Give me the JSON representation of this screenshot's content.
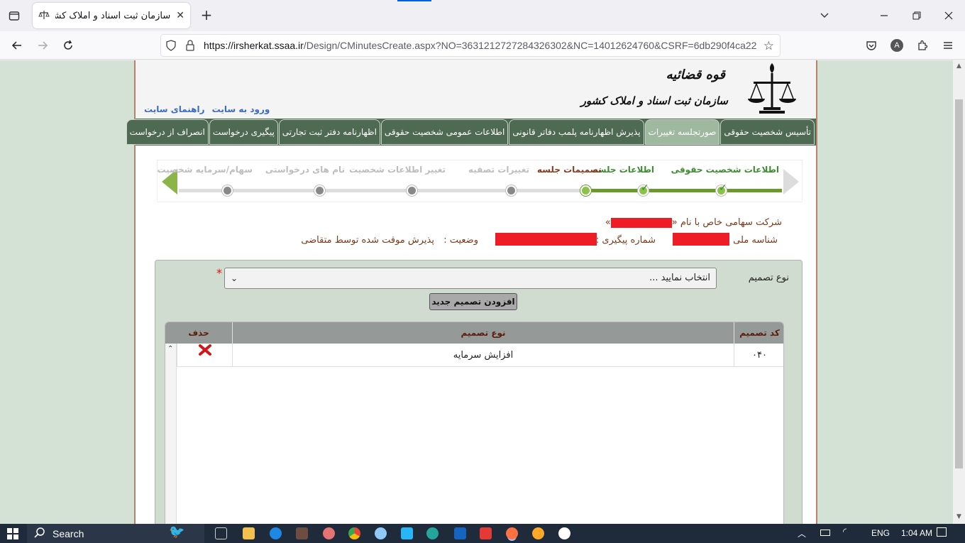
{
  "browser": {
    "tab_title": "سازمان ثبت اسناد و املاک کشور | ...",
    "url_host": "https://irsherkat.ssaa.ir",
    "url_path": "/Design/CMinutesCreate.aspx?NO=3631212727284326302&NC=14012624760&CSRF=6db290f4ca22"
  },
  "header": {
    "logo_line1": "قوه قضائیه",
    "logo_line2": "سازمان ثبت اسناد و املاک کشور",
    "links": [
      "ورود به سایت",
      "راهنمای سایت"
    ]
  },
  "menu": {
    "items": [
      {
        "label": "تأسیس شخصیت حقوقی"
      },
      {
        "label": "صورتجلسه تغییرات",
        "active": true
      },
      {
        "label": "پذیرش اظهارنامه پلمب دفاتر قانونی"
      },
      {
        "label": "اطلاعات عمومی شخصیت حقوقی"
      },
      {
        "label": "اظهارنامه دفتر ثبت تجارتی"
      },
      {
        "label": "پیگیری درخواست"
      },
      {
        "label": "انصراف از درخواست"
      }
    ]
  },
  "stepper": {
    "steps": [
      {
        "label": "اطلاعات شخصیت حقوقی",
        "state": "done"
      },
      {
        "label": "اطلاعات جلسه",
        "state": "done"
      },
      {
        "label": "تصمیمات جلسه",
        "state": "current"
      },
      {
        "label": "تغییرات تصفیه",
        "state": "todo"
      },
      {
        "label": "تغییر اطلاعات شخصیت",
        "state": "todo"
      },
      {
        "label": "نام های درخواستی",
        "state": "todo"
      },
      {
        "label": "سهام/سرمایه شخصیت",
        "state": "todo"
      }
    ]
  },
  "company": {
    "name_prefix": "شرکت سهامی خاص با نام «",
    "name_suffix": "»",
    "national_id_label": "شناسه ملی :",
    "tracking_label": "شماره پیگیری :",
    "status_label": "وضعیت :",
    "status_value": "پذیرش موقت شده توسط متقاضی"
  },
  "decision_form": {
    "type_label": "نوع تصمیم",
    "select_value": "انتخاب نمایید ...",
    "required_mark": "*",
    "add_button": "افزودن تصمیم جدید"
  },
  "decision_table": {
    "columns": [
      "کد تصمیم",
      "نوع تصمیم",
      "حذف"
    ],
    "rows": [
      {
        "code": "۰۴۰",
        "type": "افزایش سرمایه"
      }
    ]
  },
  "taskbar": {
    "search_label": "Search",
    "lang": "ENG",
    "time": "1:04 AM"
  }
}
